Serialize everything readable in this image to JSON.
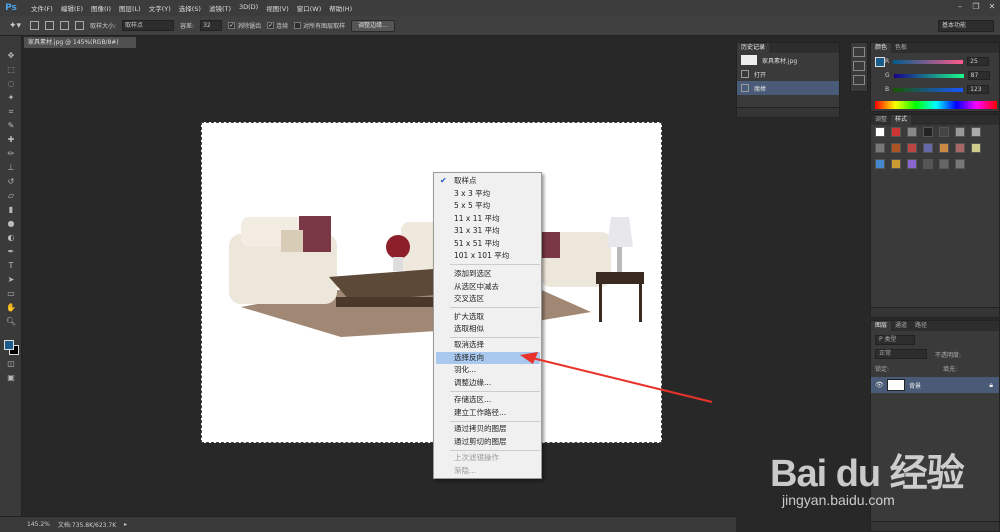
{
  "app": {
    "logo": "Ps"
  },
  "menubar": {
    "items": [
      "文件(F)",
      "编辑(E)",
      "图像(I)",
      "图层(L)",
      "文字(Y)",
      "选择(S)",
      "滤镜(T)",
      "3D(D)",
      "视图(V)",
      "窗口(W)",
      "帮助(H)"
    ],
    "window_controls": [
      "minimize-icon",
      "restore-icon",
      "close-icon"
    ]
  },
  "options": {
    "sample_size_label": "取样大小:",
    "sample_size_value": "取样点",
    "tolerance_label": "容差:",
    "tolerance_value": "32",
    "antialias_label": "消除锯齿",
    "contiguous_label": "连续",
    "all_layers_label": "对所有图层取样",
    "refine_edge_label": "调整边缘...",
    "workspace_value": "基本功能"
  },
  "document": {
    "tab_title": "家具素材.jpg @ 145%(RGB/8#)"
  },
  "context_menu": {
    "items": [
      {
        "label": "取样点",
        "checked": true
      },
      {
        "label": "3 x 3 平均"
      },
      {
        "label": "5 x 5 平均"
      },
      {
        "label": "11 x 11 平均"
      },
      {
        "label": "31 x 31 平均"
      },
      {
        "label": "51 x 51 平均"
      },
      {
        "label": "101 x 101 平均"
      },
      {
        "label": "添加到选区"
      },
      {
        "label": "从选区中减去"
      },
      {
        "label": "交叉选区"
      },
      {
        "label": "扩大选取"
      },
      {
        "label": "选取相似"
      },
      {
        "label": "取消选择"
      },
      {
        "label": "选择反向",
        "highlighted": true
      },
      {
        "label": "羽化..."
      },
      {
        "label": "调整边缘..."
      },
      {
        "label": "存储选区..."
      },
      {
        "label": "建立工作路径..."
      },
      {
        "label": "通过拷贝的图层"
      },
      {
        "label": "通过剪切的图层"
      },
      {
        "label": "上次滤镜操作",
        "disabled": true
      },
      {
        "label": "渐隐...",
        "disabled": true
      }
    ]
  },
  "status": {
    "zoom": "145.2%",
    "doc_size": "文档:735.8K/623.7K"
  },
  "history_panel": {
    "tab": "历史记录",
    "rows": [
      {
        "label": "家具素材.jpg"
      },
      {
        "label": "打开"
      },
      {
        "label": "魔棒",
        "selected": true
      }
    ]
  },
  "color_panel": {
    "tabs": [
      "颜色",
      "色板"
    ],
    "sliders": [
      {
        "label": "R",
        "value": "25"
      },
      {
        "label": "G",
        "value": "87"
      },
      {
        "label": "B",
        "value": "123"
      }
    ],
    "foreground_color": "#1b5c8c"
  },
  "styles_panel": {
    "tabs": [
      "调整",
      "样式"
    ]
  },
  "layers_panel": {
    "tabs": [
      "图层",
      "通道",
      "路径"
    ],
    "filter_label": "P 类型",
    "blend_mode": "正常",
    "opacity_label": "不透明度:",
    "lock_label": "锁定:",
    "fill_label": "填充:",
    "layer_name": "背景"
  },
  "watermark": {
    "brand": "Bai du 经验",
    "url": "jingyan.baidu.com"
  }
}
